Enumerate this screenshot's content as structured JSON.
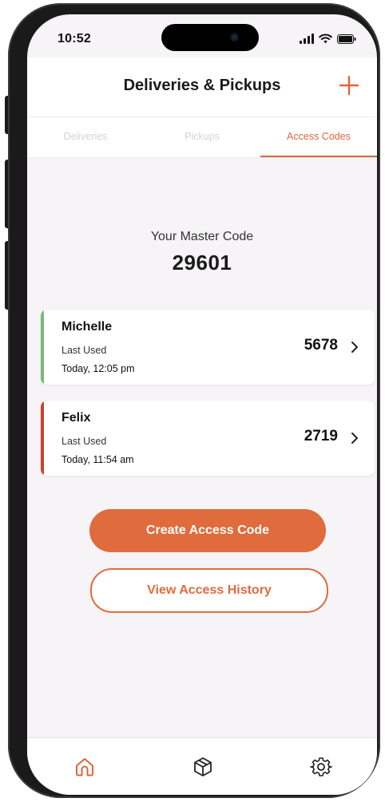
{
  "status_bar": {
    "time": "10:52"
  },
  "header": {
    "title": "Deliveries & Pickups"
  },
  "tabs": [
    {
      "label": "Deliveries",
      "active": false
    },
    {
      "label": "Pickups",
      "active": false
    },
    {
      "label": "Access Codes",
      "active": true
    }
  ],
  "master": {
    "label": "Your Master Code",
    "code": "29601"
  },
  "codes": [
    {
      "name": "Michelle",
      "last_used_label": "Last Used",
      "last_used_time": "Today, 12:05 pm",
      "code": "5678",
      "accent": "#7ab87a"
    },
    {
      "name": "Felix",
      "last_used_label": "Last Used",
      "last_used_time": "Today, 11:54 am",
      "code": "2719",
      "accent": "#c8432e"
    }
  ],
  "actions": {
    "create_label": "Create Access Code",
    "history_label": "View Access History"
  },
  "bottom_nav": [
    {
      "icon": "home-icon",
      "active": true
    },
    {
      "icon": "package-icon",
      "active": false
    },
    {
      "icon": "gear-icon",
      "active": false
    }
  ],
  "colors": {
    "accent": "#e0653a",
    "background": "#f6f4f6"
  }
}
